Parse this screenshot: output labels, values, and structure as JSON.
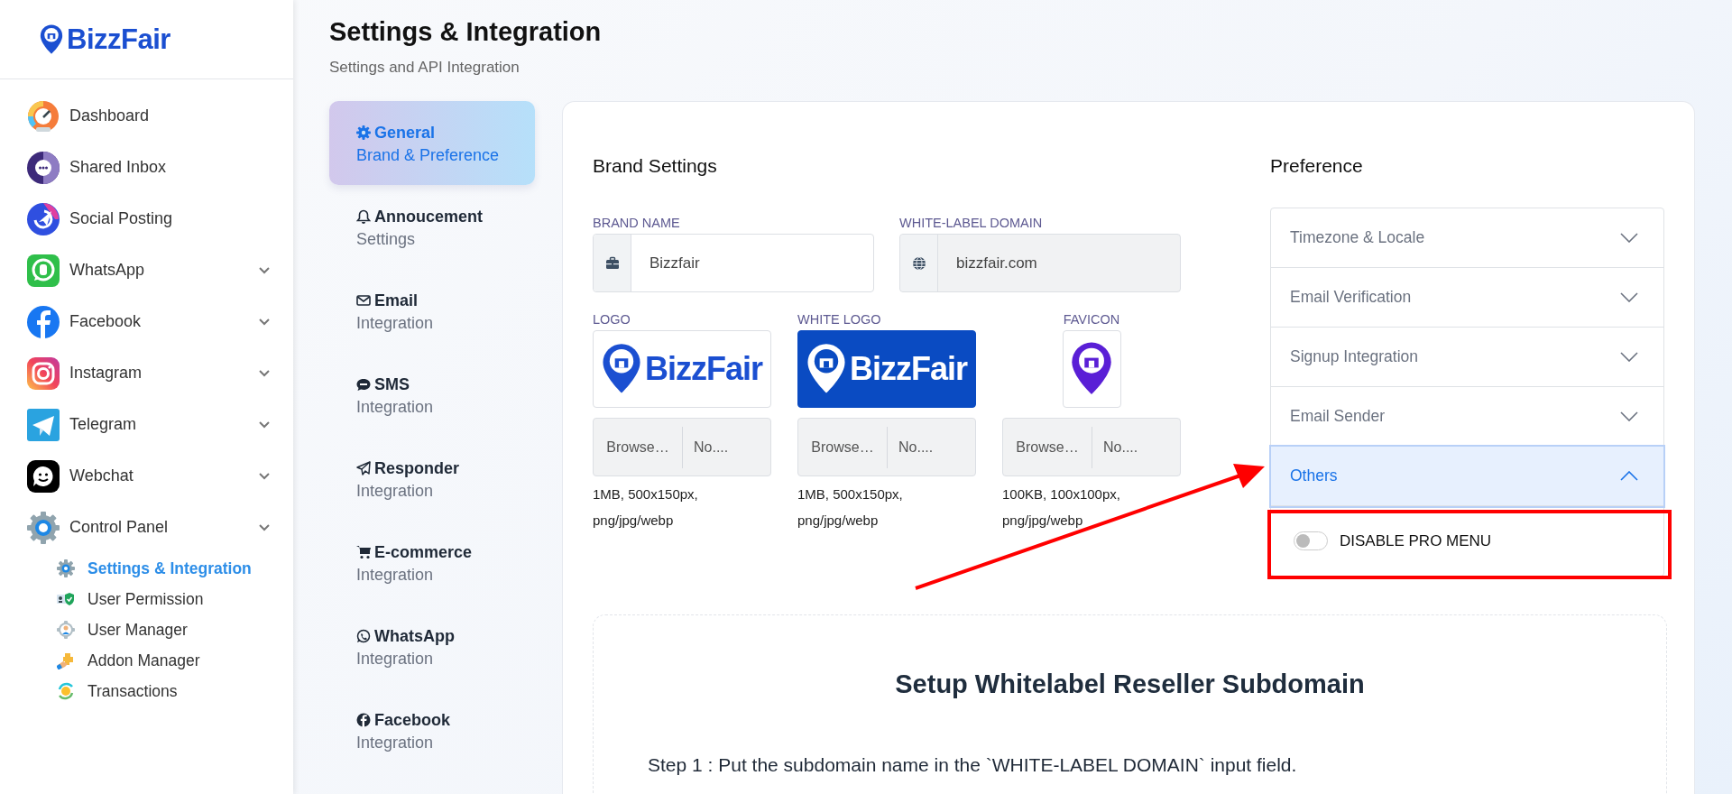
{
  "sidebar": {
    "logo": "BizzFair",
    "items": [
      {
        "label": "Dashboard",
        "has_chevron": false
      },
      {
        "label": "Shared Inbox",
        "has_chevron": false
      },
      {
        "label": "Social Posting",
        "has_chevron": false
      },
      {
        "label": "WhatsApp",
        "has_chevron": true
      },
      {
        "label": "Facebook",
        "has_chevron": true
      },
      {
        "label": "Instagram",
        "has_chevron": true
      },
      {
        "label": "Telegram",
        "has_chevron": true
      },
      {
        "label": "Webchat",
        "has_chevron": true
      },
      {
        "label": "Control Panel",
        "has_chevron": true
      }
    ],
    "subitems": [
      {
        "label": "Settings & Integration",
        "selected": true
      },
      {
        "label": "User Permission",
        "selected": false
      },
      {
        "label": "User Manager",
        "selected": false
      },
      {
        "label": "Addon Manager",
        "selected": false
      },
      {
        "label": "Transactions",
        "selected": false
      }
    ]
  },
  "header": {
    "title": "Settings & Integration",
    "subtitle": "Settings and API Integration"
  },
  "tabs": [
    {
      "label": "General",
      "sublabel": "Brand & Preference",
      "selected": true
    },
    {
      "label": "Annoucement",
      "sublabel": "Settings",
      "selected": false
    },
    {
      "label": "Email",
      "sublabel": "Integration",
      "selected": false
    },
    {
      "label": "SMS",
      "sublabel": "Integration",
      "selected": false
    },
    {
      "label": "Responder",
      "sublabel": "Integration",
      "selected": false
    },
    {
      "label": "E-commerce",
      "sublabel": "Integration",
      "selected": false
    },
    {
      "label": "WhatsApp",
      "sublabel": "Integration",
      "selected": false
    },
    {
      "label": "Facebook",
      "sublabel": "Integration",
      "selected": false
    }
  ],
  "brand_settings": {
    "title": "Brand Settings",
    "fields": [
      {
        "label": "BRAND NAME",
        "value": "Bizzfair",
        "disabled": false
      },
      {
        "label": "WHITE-LABEL DOMAIN",
        "value": "bizzfair.com",
        "disabled": true
      }
    ],
    "uploads": [
      {
        "kind": "logo",
        "label": "LOGO",
        "logo_text": "BizzFair",
        "browse": "Browse…",
        "file": "No....",
        "hint": "1MB, 500x150px, png/jpg/webp"
      },
      {
        "kind": "white_logo",
        "label": "WHITE LOGO",
        "logo_text": "BizzFair",
        "browse": "Browse…",
        "file": "No....",
        "hint": "1MB, 500x150px, png/jpg/webp"
      },
      {
        "kind": "favicon",
        "label": "FAVICON",
        "browse": "Browse…",
        "file": "No....",
        "hint": "100KB, 100x100px, png/jpg/webp"
      }
    ]
  },
  "preference": {
    "title": "Preference",
    "sections": [
      {
        "label": "Timezone & Locale",
        "expanded": false
      },
      {
        "label": "Email Verification",
        "expanded": false
      },
      {
        "label": "Signup Integration",
        "expanded": false
      },
      {
        "label": "Email Sender",
        "expanded": false
      },
      {
        "label": "Others",
        "expanded": true,
        "options": [
          {
            "label": "DISABLE PRO MENU",
            "on": false
          }
        ]
      }
    ]
  },
  "setup": {
    "title": "Setup Whitelabel Reseller Subdomain",
    "steps": [
      "Step 1 : Put the subdomain name in the `WHITE-LABEL DOMAIN` input field."
    ]
  }
}
